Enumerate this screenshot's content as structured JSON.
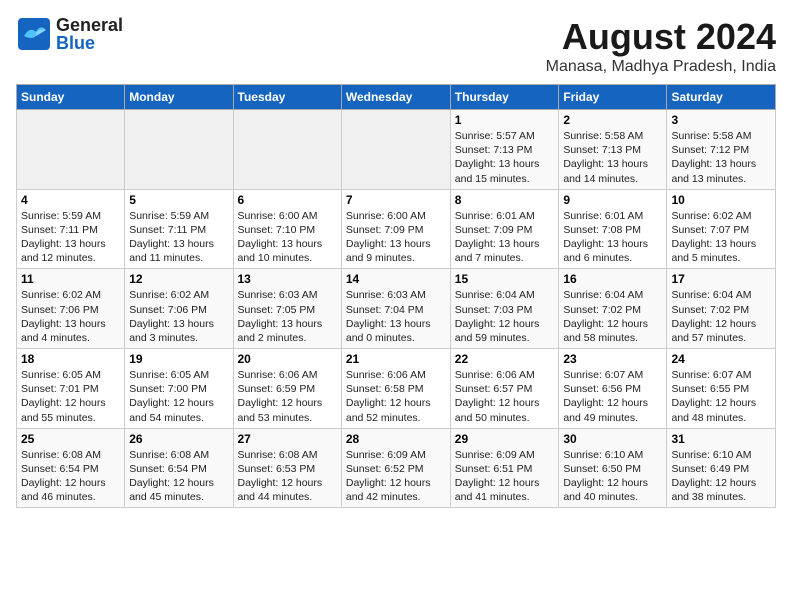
{
  "header": {
    "logo_general": "General",
    "logo_blue": "Blue",
    "month_year": "August 2024",
    "location": "Manasa, Madhya Pradesh, India"
  },
  "weekdays": [
    "Sunday",
    "Monday",
    "Tuesday",
    "Wednesday",
    "Thursday",
    "Friday",
    "Saturday"
  ],
  "weeks": [
    [
      {
        "day": "",
        "info": ""
      },
      {
        "day": "",
        "info": ""
      },
      {
        "day": "",
        "info": ""
      },
      {
        "day": "",
        "info": ""
      },
      {
        "day": "1",
        "info": "Sunrise: 5:57 AM\nSunset: 7:13 PM\nDaylight: 13 hours\nand 15 minutes."
      },
      {
        "day": "2",
        "info": "Sunrise: 5:58 AM\nSunset: 7:13 PM\nDaylight: 13 hours\nand 14 minutes."
      },
      {
        "day": "3",
        "info": "Sunrise: 5:58 AM\nSunset: 7:12 PM\nDaylight: 13 hours\nand 13 minutes."
      }
    ],
    [
      {
        "day": "4",
        "info": "Sunrise: 5:59 AM\nSunset: 7:11 PM\nDaylight: 13 hours\nand 12 minutes."
      },
      {
        "day": "5",
        "info": "Sunrise: 5:59 AM\nSunset: 7:11 PM\nDaylight: 13 hours\nand 11 minutes."
      },
      {
        "day": "6",
        "info": "Sunrise: 6:00 AM\nSunset: 7:10 PM\nDaylight: 13 hours\nand 10 minutes."
      },
      {
        "day": "7",
        "info": "Sunrise: 6:00 AM\nSunset: 7:09 PM\nDaylight: 13 hours\nand 9 minutes."
      },
      {
        "day": "8",
        "info": "Sunrise: 6:01 AM\nSunset: 7:09 PM\nDaylight: 13 hours\nand 7 minutes."
      },
      {
        "day": "9",
        "info": "Sunrise: 6:01 AM\nSunset: 7:08 PM\nDaylight: 13 hours\nand 6 minutes."
      },
      {
        "day": "10",
        "info": "Sunrise: 6:02 AM\nSunset: 7:07 PM\nDaylight: 13 hours\nand 5 minutes."
      }
    ],
    [
      {
        "day": "11",
        "info": "Sunrise: 6:02 AM\nSunset: 7:06 PM\nDaylight: 13 hours\nand 4 minutes."
      },
      {
        "day": "12",
        "info": "Sunrise: 6:02 AM\nSunset: 7:06 PM\nDaylight: 13 hours\nand 3 minutes."
      },
      {
        "day": "13",
        "info": "Sunrise: 6:03 AM\nSunset: 7:05 PM\nDaylight: 13 hours\nand 2 minutes."
      },
      {
        "day": "14",
        "info": "Sunrise: 6:03 AM\nSunset: 7:04 PM\nDaylight: 13 hours\nand 0 minutes."
      },
      {
        "day": "15",
        "info": "Sunrise: 6:04 AM\nSunset: 7:03 PM\nDaylight: 12 hours\nand 59 minutes."
      },
      {
        "day": "16",
        "info": "Sunrise: 6:04 AM\nSunset: 7:02 PM\nDaylight: 12 hours\nand 58 minutes."
      },
      {
        "day": "17",
        "info": "Sunrise: 6:04 AM\nSunset: 7:02 PM\nDaylight: 12 hours\nand 57 minutes."
      }
    ],
    [
      {
        "day": "18",
        "info": "Sunrise: 6:05 AM\nSunset: 7:01 PM\nDaylight: 12 hours\nand 55 minutes."
      },
      {
        "day": "19",
        "info": "Sunrise: 6:05 AM\nSunset: 7:00 PM\nDaylight: 12 hours\nand 54 minutes."
      },
      {
        "day": "20",
        "info": "Sunrise: 6:06 AM\nSunset: 6:59 PM\nDaylight: 12 hours\nand 53 minutes."
      },
      {
        "day": "21",
        "info": "Sunrise: 6:06 AM\nSunset: 6:58 PM\nDaylight: 12 hours\nand 52 minutes."
      },
      {
        "day": "22",
        "info": "Sunrise: 6:06 AM\nSunset: 6:57 PM\nDaylight: 12 hours\nand 50 minutes."
      },
      {
        "day": "23",
        "info": "Sunrise: 6:07 AM\nSunset: 6:56 PM\nDaylight: 12 hours\nand 49 minutes."
      },
      {
        "day": "24",
        "info": "Sunrise: 6:07 AM\nSunset: 6:55 PM\nDaylight: 12 hours\nand 48 minutes."
      }
    ],
    [
      {
        "day": "25",
        "info": "Sunrise: 6:08 AM\nSunset: 6:54 PM\nDaylight: 12 hours\nand 46 minutes."
      },
      {
        "day": "26",
        "info": "Sunrise: 6:08 AM\nSunset: 6:54 PM\nDaylight: 12 hours\nand 45 minutes."
      },
      {
        "day": "27",
        "info": "Sunrise: 6:08 AM\nSunset: 6:53 PM\nDaylight: 12 hours\nand 44 minutes."
      },
      {
        "day": "28",
        "info": "Sunrise: 6:09 AM\nSunset: 6:52 PM\nDaylight: 12 hours\nand 42 minutes."
      },
      {
        "day": "29",
        "info": "Sunrise: 6:09 AM\nSunset: 6:51 PM\nDaylight: 12 hours\nand 41 minutes."
      },
      {
        "day": "30",
        "info": "Sunrise: 6:10 AM\nSunset: 6:50 PM\nDaylight: 12 hours\nand 40 minutes."
      },
      {
        "day": "31",
        "info": "Sunrise: 6:10 AM\nSunset: 6:49 PM\nDaylight: 12 hours\nand 38 minutes."
      }
    ]
  ]
}
